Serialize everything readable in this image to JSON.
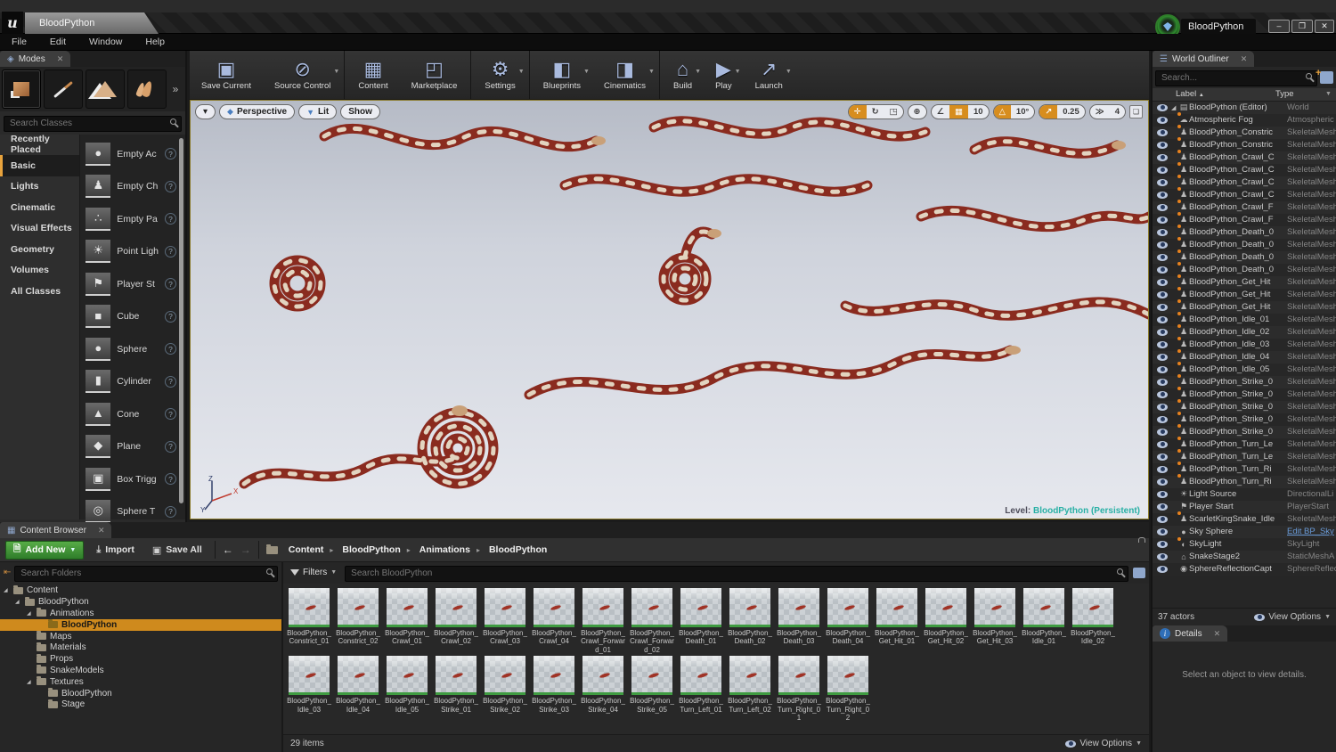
{
  "window": {
    "logo": "u",
    "tab_title": "BloodPython",
    "menu": [
      "File",
      "Edit",
      "Window",
      "Help"
    ],
    "project_badge": "BloodPython"
  },
  "toolbar": {
    "buttons": [
      {
        "label": "Save Current",
        "icon": "save",
        "dropdown": false,
        "sep": false
      },
      {
        "label": "Source Control",
        "icon": "source-control",
        "dropdown": true,
        "sep": false
      },
      {
        "label": "Content",
        "icon": "content",
        "dropdown": false,
        "sep": true
      },
      {
        "label": "Marketplace",
        "icon": "marketplace",
        "dropdown": false,
        "sep": false
      },
      {
        "label": "Settings",
        "icon": "settings",
        "dropdown": true,
        "sep": true
      },
      {
        "label": "Blueprints",
        "icon": "blueprints",
        "dropdown": true,
        "sep": true
      },
      {
        "label": "Cinematics",
        "icon": "cinematics",
        "dropdown": true,
        "sep": false
      },
      {
        "label": "Build",
        "icon": "build",
        "dropdown": true,
        "sep": true
      },
      {
        "label": "Play",
        "icon": "play",
        "dropdown": true,
        "sep": false
      },
      {
        "label": "Launch",
        "icon": "launch",
        "dropdown": true,
        "sep": false
      }
    ]
  },
  "modes": {
    "title": "Modes",
    "search_placeholder": "Search Classes",
    "mode_tabs": [
      {
        "name": "place",
        "selected": true
      },
      {
        "name": "paint",
        "selected": false
      },
      {
        "name": "landscape",
        "selected": false
      },
      {
        "name": "foliage",
        "selected": false
      }
    ],
    "categories": [
      {
        "label": "Recently Placed",
        "selected": false
      },
      {
        "label": "Basic",
        "selected": true
      },
      {
        "label": "Lights",
        "selected": false
      },
      {
        "label": "Cinematic",
        "selected": false
      },
      {
        "label": "Visual Effects",
        "selected": false
      },
      {
        "label": "Geometry",
        "selected": false
      },
      {
        "label": "Volumes",
        "selected": false
      },
      {
        "label": "All Classes",
        "selected": false
      }
    ],
    "items": [
      {
        "label": "Empty Ac",
        "icon": "empty-actor"
      },
      {
        "label": "Empty Ch",
        "icon": "empty-character"
      },
      {
        "label": "Empty Pa",
        "icon": "empty-pawn"
      },
      {
        "label": "Point Ligh",
        "icon": "point-light"
      },
      {
        "label": "Player St",
        "icon": "player-start"
      },
      {
        "label": "Cube",
        "icon": "cube"
      },
      {
        "label": "Sphere",
        "icon": "sphere"
      },
      {
        "label": "Cylinder",
        "icon": "cylinder"
      },
      {
        "label": "Cone",
        "icon": "cone"
      },
      {
        "label": "Plane",
        "icon": "plane"
      },
      {
        "label": "Box Trigg",
        "icon": "box-trigger"
      },
      {
        "label": "Sphere T",
        "icon": "sphere-trigger"
      }
    ]
  },
  "viewport": {
    "camera_mode": "Perspective",
    "view_mode": "Lit",
    "show_label": "Show",
    "grid_snap_value": "10",
    "rotation_snap_value": "10°",
    "scale_snap_value": "0.25",
    "camera_speed": "4",
    "level_label": "Level:",
    "level_value": "BloodPython (Persistent)",
    "axis": {
      "x": "X",
      "y": "Y",
      "z": "Z"
    }
  },
  "outliner": {
    "title": "World Outliner",
    "search_placeholder": "Search...",
    "columns": {
      "label": "Label",
      "type": "Type"
    },
    "rows": [
      {
        "label": "BloodPython (Editor)",
        "type": "World",
        "icon": "world",
        "expand": true,
        "dot": false,
        "link": false
      },
      {
        "label": "Atmospheric Fog",
        "type": "Atmospheric",
        "icon": "fog",
        "dot": true,
        "link": false
      },
      {
        "label": "BloodPython_Constric",
        "type": "SkeletalMesh",
        "icon": "skelmesh",
        "dot": true,
        "link": false
      },
      {
        "label": "BloodPython_Constric",
        "type": "SkeletalMesh",
        "icon": "skelmesh",
        "dot": true,
        "link": false
      },
      {
        "label": "BloodPython_Crawl_C",
        "type": "SkeletalMesh",
        "icon": "skelmesh",
        "dot": true,
        "link": false
      },
      {
        "label": "BloodPython_Crawl_C",
        "type": "SkeletalMesh",
        "icon": "skelmesh",
        "dot": true,
        "link": false
      },
      {
        "label": "BloodPython_Crawl_C",
        "type": "SkeletalMesh",
        "icon": "skelmesh",
        "dot": true,
        "link": false
      },
      {
        "label": "BloodPython_Crawl_C",
        "type": "SkeletalMesh",
        "icon": "skelmesh",
        "dot": true,
        "link": false
      },
      {
        "label": "BloodPython_Crawl_F",
        "type": "SkeletalMesh",
        "icon": "skelmesh",
        "dot": true,
        "link": false
      },
      {
        "label": "BloodPython_Crawl_F",
        "type": "SkeletalMesh",
        "icon": "skelmesh",
        "dot": true,
        "link": false
      },
      {
        "label": "BloodPython_Death_0",
        "type": "SkeletalMesh",
        "icon": "skelmesh",
        "dot": true,
        "link": false
      },
      {
        "label": "BloodPython_Death_0",
        "type": "SkeletalMesh",
        "icon": "skelmesh",
        "dot": true,
        "link": false
      },
      {
        "label": "BloodPython_Death_0",
        "type": "SkeletalMesh",
        "icon": "skelmesh",
        "dot": true,
        "link": false
      },
      {
        "label": "BloodPython_Death_0",
        "type": "SkeletalMesh",
        "icon": "skelmesh",
        "dot": true,
        "link": false
      },
      {
        "label": "BloodPython_Get_Hit",
        "type": "SkeletalMesh",
        "icon": "skelmesh",
        "dot": true,
        "link": false
      },
      {
        "label": "BloodPython_Get_Hit",
        "type": "SkeletalMesh",
        "icon": "skelmesh",
        "dot": true,
        "link": false
      },
      {
        "label": "BloodPython_Get_Hit",
        "type": "SkeletalMesh",
        "icon": "skelmesh",
        "dot": true,
        "link": false
      },
      {
        "label": "BloodPython_Idle_01",
        "type": "SkeletalMesh",
        "icon": "skelmesh",
        "dot": true,
        "link": false
      },
      {
        "label": "BloodPython_Idle_02",
        "type": "SkeletalMesh",
        "icon": "skelmesh",
        "dot": true,
        "link": false
      },
      {
        "label": "BloodPython_Idle_03",
        "type": "SkeletalMesh",
        "icon": "skelmesh",
        "dot": true,
        "link": false
      },
      {
        "label": "BloodPython_Idle_04",
        "type": "SkeletalMesh",
        "icon": "skelmesh",
        "dot": true,
        "link": false
      },
      {
        "label": "BloodPython_Idle_05",
        "type": "SkeletalMesh",
        "icon": "skelmesh",
        "dot": true,
        "link": false
      },
      {
        "label": "BloodPython_Strike_0",
        "type": "SkeletalMesh",
        "icon": "skelmesh",
        "dot": true,
        "link": false
      },
      {
        "label": "BloodPython_Strike_0",
        "type": "SkeletalMesh",
        "icon": "skelmesh",
        "dot": true,
        "link": false
      },
      {
        "label": "BloodPython_Strike_0",
        "type": "SkeletalMesh",
        "icon": "skelmesh",
        "dot": true,
        "link": false
      },
      {
        "label": "BloodPython_Strike_0",
        "type": "SkeletalMesh",
        "icon": "skelmesh",
        "dot": true,
        "link": false
      },
      {
        "label": "BloodPython_Strike_0",
        "type": "SkeletalMesh",
        "icon": "skelmesh",
        "dot": true,
        "link": false
      },
      {
        "label": "BloodPython_Turn_Le",
        "type": "SkeletalMesh",
        "icon": "skelmesh",
        "dot": true,
        "link": false
      },
      {
        "label": "BloodPython_Turn_Le",
        "type": "SkeletalMesh",
        "icon": "skelmesh",
        "dot": true,
        "link": false
      },
      {
        "label": "BloodPython_Turn_Ri",
        "type": "SkeletalMesh",
        "icon": "skelmesh",
        "dot": true,
        "link": false
      },
      {
        "label": "BloodPython_Turn_Ri",
        "type": "SkeletalMesh",
        "icon": "skelmesh",
        "dot": true,
        "link": false
      },
      {
        "label": "Light Source",
        "type": "DirectionalLi",
        "icon": "dirlight",
        "dot": false,
        "link": false
      },
      {
        "label": "Player Start",
        "type": "PlayerStart",
        "icon": "playerstart",
        "dot": false,
        "link": false
      },
      {
        "label": "ScarletKingSnake_Idle",
        "type": "SkeletalMesh",
        "icon": "skelmesh",
        "dot": true,
        "link": false
      },
      {
        "label": "Sky Sphere",
        "type": "Edit BP_Sky",
        "icon": "skysphere",
        "dot": false,
        "link": true
      },
      {
        "label": "SkyLight",
        "type": "SkyLight",
        "icon": "skylight",
        "dot": true,
        "link": false
      },
      {
        "label": "SnakeStage2",
        "type": "StaticMeshA",
        "icon": "staticmesh",
        "dot": false,
        "link": false
      },
      {
        "label": "SphereReflectionCapt",
        "type": "SphereReflec",
        "icon": "reflection",
        "dot": false,
        "link": false
      }
    ],
    "footer": {
      "actor_count": "37 actors",
      "view_options": "View Options"
    }
  },
  "details": {
    "title": "Details",
    "empty_text": "Select an object to view details."
  },
  "content_browser": {
    "title": "Content Browser",
    "add_new": "Add New",
    "import": "Import",
    "save_all": "Save All",
    "breadcrumbs": [
      "Content",
      "BloodPython",
      "Animations",
      "BloodPython"
    ],
    "folders_search_placeholder": "Search Folders",
    "filters_label": "Filters",
    "search_placeholder": "Search BloodPython",
    "tree": [
      {
        "label": "Content",
        "depth": 0,
        "arrow": true,
        "selected": false
      },
      {
        "label": "BloodPython",
        "depth": 1,
        "arrow": true,
        "selected": false
      },
      {
        "label": "Animations",
        "depth": 2,
        "arrow": true,
        "selected": false
      },
      {
        "label": "BloodPython",
        "depth": 3,
        "arrow": false,
        "selected": true
      },
      {
        "label": "Maps",
        "depth": 2,
        "arrow": false,
        "selected": false
      },
      {
        "label": "Materials",
        "depth": 2,
        "arrow": false,
        "selected": false
      },
      {
        "label": "Props",
        "depth": 2,
        "arrow": false,
        "selected": false
      },
      {
        "label": "SnakeModels",
        "depth": 2,
        "arrow": false,
        "selected": false
      },
      {
        "label": "Textures",
        "depth": 2,
        "arrow": true,
        "selected": false
      },
      {
        "label": "BloodPython",
        "depth": 3,
        "arrow": false,
        "selected": false
      },
      {
        "label": "Stage",
        "depth": 3,
        "arrow": false,
        "selected": false
      }
    ],
    "assets_row1": [
      "BloodPython_Constrict_01",
      "BloodPython_Constrict_02",
      "BloodPython_Crawl_01",
      "BloodPython_Crawl_02",
      "BloodPython_Crawl_03",
      "BloodPython_Crawl_04",
      "BloodPython_Crawl_Forward_01",
      "BloodPython_Crawl_Forward_02",
      "BloodPython_Death_01",
      "BloodPython_Death_02",
      "BloodPython_Death_03",
      "BloodPython_Death_04",
      "BloodPython_Get_Hit_01",
      "BloodPython_Get_Hit_02",
      "BloodPython_Get_Hit_03",
      "BloodPython_Idle_01",
      "BloodPython_Idle_02"
    ],
    "assets_row2": [
      "BloodPython_Idle_03",
      "BloodPython_Idle_04",
      "BloodPython_Idle_05",
      "BloodPython_Strike_01",
      "BloodPython_Strike_02",
      "BloodPython_Strike_03",
      "BloodPython_Strike_04",
      "BloodPython_Strike_05",
      "BloodPython_Turn_Left_01",
      "BloodPython_Turn_Left_02",
      "BloodPython_Turn_Right_01",
      "BloodPython_Turn_Right_02"
    ],
    "items_count": "29 items",
    "view_options": "View Options"
  },
  "colors": {
    "selection_orange": "#cf8a1d",
    "accent_orange": "#d78d1e",
    "save_green": "#3f9b41",
    "link_blue": "#6a9bd8",
    "level_teal": "#28b0a5",
    "toolbar_icon_blue": "#a9bade"
  }
}
